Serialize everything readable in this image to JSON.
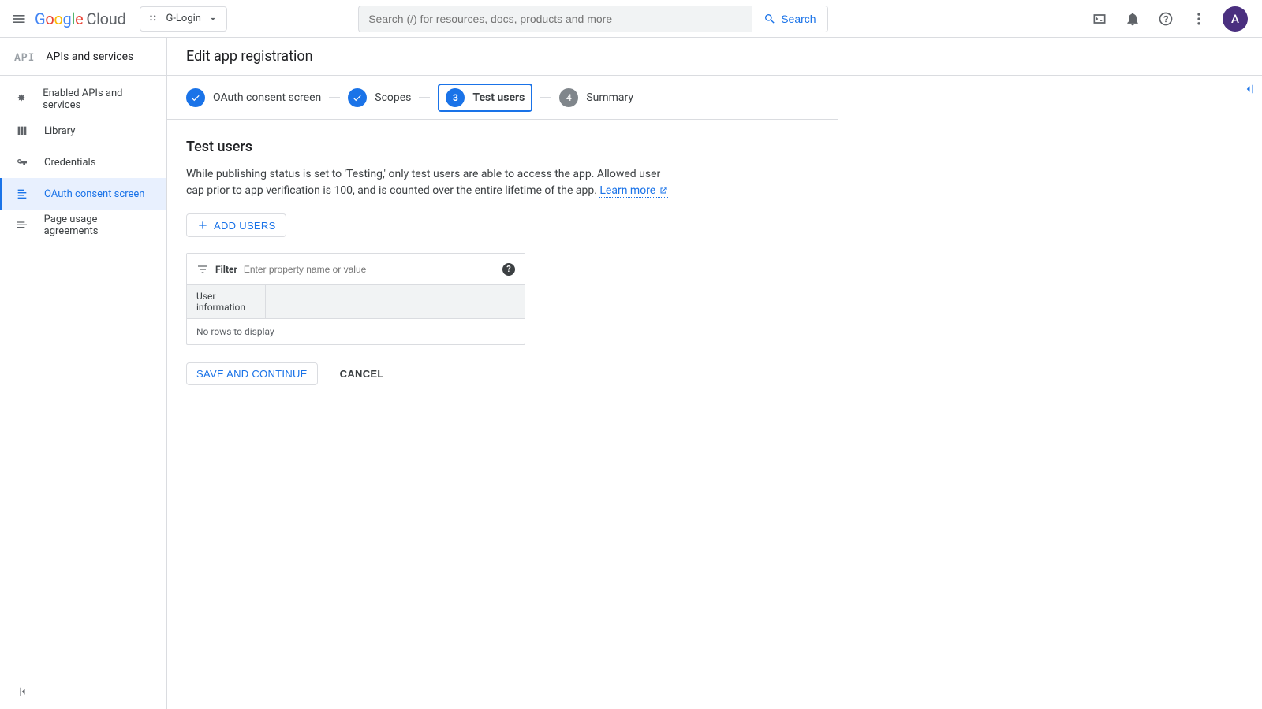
{
  "header": {
    "brand_cloud": "Cloud",
    "project_name": "G-Login",
    "search_placeholder": "Search (/) for resources, docs, products and more",
    "search_button": "Search",
    "avatar_letter": "A"
  },
  "sidebar": {
    "title": "APIs and services",
    "items": [
      {
        "label": "Enabled APIs and services",
        "icon": "enabled"
      },
      {
        "label": "Library",
        "icon": "library"
      },
      {
        "label": "Credentials",
        "icon": "key"
      },
      {
        "label": "OAuth consent screen",
        "icon": "consent",
        "active": true
      },
      {
        "label": "Page usage agreements",
        "icon": "agreements"
      }
    ]
  },
  "page": {
    "title": "Edit app registration"
  },
  "stepper": {
    "steps": [
      {
        "label": "OAuth consent screen",
        "state": "done"
      },
      {
        "label": "Scopes",
        "state": "done"
      },
      {
        "label": "Test users",
        "state": "current",
        "number": "3"
      },
      {
        "label": "Summary",
        "state": "pending",
        "number": "4"
      }
    ]
  },
  "section": {
    "heading": "Test users",
    "description": "While publishing status is set to 'Testing,' only test users are able to access the app. Allowed user cap prior to app verification is 100, and is counted over the entire lifetime of the app. ",
    "learn_more": "Learn more",
    "add_users": "ADD USERS",
    "filter_label": "Filter",
    "filter_placeholder": "Enter property name or value",
    "column_header": "User information",
    "empty": "No rows to display",
    "save": "SAVE AND CONTINUE",
    "cancel": "CANCEL"
  }
}
